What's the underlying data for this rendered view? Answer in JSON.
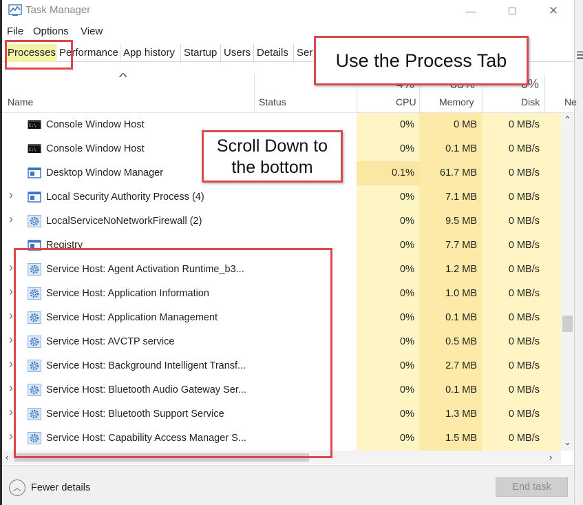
{
  "window": {
    "title": "Task Manager",
    "controls": {
      "minimize": "—",
      "maximize": "☐",
      "close": "✕"
    }
  },
  "menu": [
    "File",
    "Options",
    "View"
  ],
  "tabs": [
    {
      "label": "Processes",
      "active": true
    },
    {
      "label": "Performance"
    },
    {
      "label": "App history"
    },
    {
      "label": "Startup"
    },
    {
      "label": "Users"
    },
    {
      "label": "Details"
    },
    {
      "label": "Ser"
    }
  ],
  "columns": {
    "name": "Name",
    "status": "Status",
    "cpu": {
      "label": "CPU",
      "percent": "4%"
    },
    "memory": {
      "label": "Memory",
      "percent": "83%"
    },
    "disk": {
      "label": "Disk",
      "percent": "0%"
    },
    "network": {
      "label": "Ne"
    }
  },
  "processes": [
    {
      "name": "Console Window Host",
      "expandable": false,
      "icon": "console-icon",
      "cpu": "0%",
      "memory": "0 MB",
      "disk": "0 MB/s"
    },
    {
      "name": "Console Window Host",
      "expandable": false,
      "icon": "console-icon",
      "cpu": "0%",
      "memory": "0.1 MB",
      "disk": "0 MB/s"
    },
    {
      "name": "Desktop Window Manager",
      "expandable": false,
      "icon": "window-app-icon",
      "cpu": "0.1%",
      "memory": "61.7 MB",
      "disk": "0 MB/s",
      "cpu_highlight": true
    },
    {
      "name": "Local Security Authority Process (4)",
      "expandable": true,
      "icon": "window-app-icon",
      "cpu": "0%",
      "memory": "7.1 MB",
      "disk": "0 MB/s"
    },
    {
      "name": "LocalServiceNoNetworkFirewall (2)",
      "expandable": true,
      "icon": "gear-icon",
      "cpu": "0%",
      "memory": "9.5 MB",
      "disk": "0 MB/s"
    },
    {
      "name": "Registry",
      "expandable": false,
      "icon": "window-app-icon",
      "cpu": "0%",
      "memory": "7.7 MB",
      "disk": "0 MB/s"
    },
    {
      "name": "Service Host: Agent Activation Runtime_b3...",
      "expandable": true,
      "icon": "gear-icon",
      "cpu": "0%",
      "memory": "1.2 MB",
      "disk": "0 MB/s"
    },
    {
      "name": "Service Host: Application Information",
      "expandable": true,
      "icon": "gear-icon",
      "cpu": "0%",
      "memory": "1.0 MB",
      "disk": "0 MB/s"
    },
    {
      "name": "Service Host: Application Management",
      "expandable": true,
      "icon": "gear-icon",
      "cpu": "0%",
      "memory": "0.1 MB",
      "disk": "0 MB/s"
    },
    {
      "name": "Service Host: AVCTP service",
      "expandable": true,
      "icon": "gear-icon",
      "cpu": "0%",
      "memory": "0.5 MB",
      "disk": "0 MB/s"
    },
    {
      "name": "Service Host: Background Intelligent Transf...",
      "expandable": true,
      "icon": "gear-icon",
      "cpu": "0%",
      "memory": "2.7 MB",
      "disk": "0 MB/s"
    },
    {
      "name": "Service Host: Bluetooth Audio Gateway Ser...",
      "expandable": true,
      "icon": "gear-icon",
      "cpu": "0%",
      "memory": "0.1 MB",
      "disk": "0 MB/s"
    },
    {
      "name": "Service Host: Bluetooth Support Service",
      "expandable": true,
      "icon": "gear-icon",
      "cpu": "0%",
      "memory": "1.3 MB",
      "disk": "0 MB/s"
    },
    {
      "name": "Service Host: Capability Access Manager S...",
      "expandable": true,
      "icon": "gear-icon",
      "cpu": "0%",
      "memory": "1.5 MB",
      "disk": "0 MB/s"
    }
  ],
  "footer": {
    "fewer_details": "Fewer details",
    "end_task": "End task"
  },
  "annotations": {
    "tab_callout": "Use the Process Tab",
    "scroll_callout_line1": "Scroll Down to",
    "scroll_callout_line2": "the bottom"
  },
  "colors": {
    "cpu_band": "#fff4c4",
    "memory_band": "#fde9a8",
    "cpu_highlight": "#fbe7a1",
    "annotation_red": "#e0474c",
    "tab_highlight": "#f3f3a8"
  }
}
